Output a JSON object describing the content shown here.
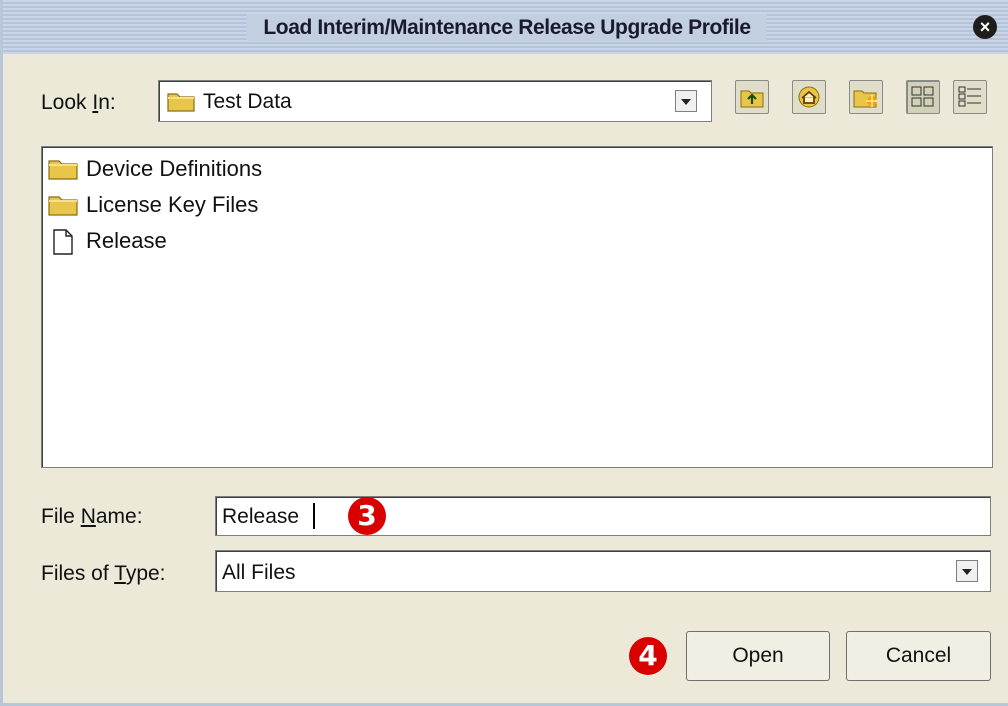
{
  "dialog": {
    "title": "Load Interim/Maintenance Release Upgrade Profile",
    "close_glyph": "×"
  },
  "look_in": {
    "label_before": "Look ",
    "label_mnemonic": "I",
    "label_after": "n:",
    "value": "Test Data",
    "value_icon": "folder-icon"
  },
  "toolbar": {
    "buttons": [
      {
        "icon": "up-one-level-icon"
      },
      {
        "icon": "home-icon"
      },
      {
        "icon": "new-folder-icon"
      },
      {
        "icon": "list-view-icon"
      },
      {
        "icon": "details-view-icon"
      }
    ]
  },
  "files": [
    {
      "name": "Device Definitions",
      "icon": "folder-icon"
    },
    {
      "name": "License Key Files",
      "icon": "folder-icon"
    },
    {
      "name": "Release",
      "icon": "file-icon"
    }
  ],
  "file_name": {
    "label_before": "File ",
    "label_mnemonic": "N",
    "label_after": "ame:",
    "value": "Release"
  },
  "files_of_type": {
    "label_before": "Files of ",
    "label_mnemonic": "T",
    "label_after": "ype:",
    "value": "All Files"
  },
  "markers": {
    "step3": "3",
    "step4": "4"
  },
  "buttons": {
    "open": "Open",
    "cancel": "Cancel"
  },
  "colors": {
    "dialog_bg": "#ece9d8",
    "titlebar": "#b4c4da",
    "marker": "#d90000"
  }
}
